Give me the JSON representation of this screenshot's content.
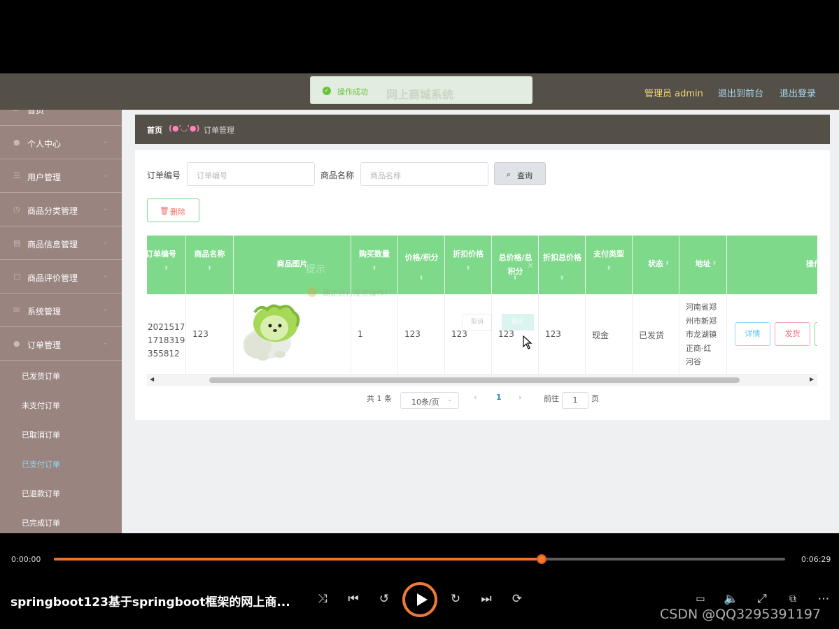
{
  "app": {
    "title": "网上商城系统",
    "user_label": "管理员 admin",
    "front_link": "退出到前台",
    "logout_link": "退出登录"
  },
  "toast": {
    "message": "操作成功"
  },
  "sidebar": {
    "items": [
      {
        "label": "首页",
        "icon": "home-icon"
      },
      {
        "label": "个人中心",
        "icon": "user-icon"
      },
      {
        "label": "用户管理",
        "icon": "list-icon"
      },
      {
        "label": "商品分类管理",
        "icon": "category-icon"
      },
      {
        "label": "商品信息管理",
        "icon": "goods-icon"
      },
      {
        "label": "商品评价管理",
        "icon": "comment-icon"
      },
      {
        "label": "系统管理",
        "icon": "system-icon"
      },
      {
        "label": "订单管理",
        "icon": "order-icon"
      }
    ],
    "sub_items": [
      {
        "label": "已发货订单"
      },
      {
        "label": "未支付订单"
      },
      {
        "label": "已取消订单"
      },
      {
        "label": "已支付订单",
        "active": true
      },
      {
        "label": "已退款订单"
      },
      {
        "label": "已完成订单"
      }
    ]
  },
  "breadcrumb": {
    "home": "首页",
    "separator": "(●'◡'●)",
    "current": "订单管理"
  },
  "filters": {
    "order_no_label": "订单编号",
    "order_no_placeholder": "订单编号",
    "goods_name_label": "商品名称",
    "goods_name_placeholder": "商品名称",
    "search_button": "查询",
    "delete_button": "删除"
  },
  "table": {
    "headers": [
      "订单编号",
      "商品名称",
      "商品图片",
      "购买数量",
      "价格/积分",
      "折扣价格",
      "总价格/总积分",
      "折扣总价格",
      "支付类型",
      "状态",
      "地址",
      "操作"
    ],
    "rows": [
      {
        "order_no": "20215171718319355812",
        "order_no_display": "2021517\n1718319\n355812",
        "goods_name": "123",
        "quantity": "1",
        "price": "123",
        "discount_price": "123",
        "total_price": "123",
        "discount_total": "123",
        "pay_type": "现金",
        "status": "已发货",
        "address": "河南省郑州市新郑市龙湖镇正商·红河谷",
        "address_display": "河南省郑\n州市新郑\n市龙湖镇\n正商·红\n河谷",
        "actions": [
          "详情",
          "发货"
        ]
      }
    ]
  },
  "ghost_dialog": {
    "title": "提示",
    "message": "确定进行发货操作?",
    "cancel": "取消",
    "confirm": "确定"
  },
  "pagination": {
    "total_text": "共 1 条",
    "page_size": "10条/页",
    "current_page": "1",
    "goto_label": "前往",
    "goto_value": "1",
    "page_unit": "页"
  },
  "player": {
    "current_time": "0:00:00",
    "duration": "0:06:29",
    "progress": 0.667,
    "title": "springboot123基于springboot框架的网上商...",
    "watermark": "CSDN @QQ3295391197",
    "accent_color": "#f2702b"
  }
}
